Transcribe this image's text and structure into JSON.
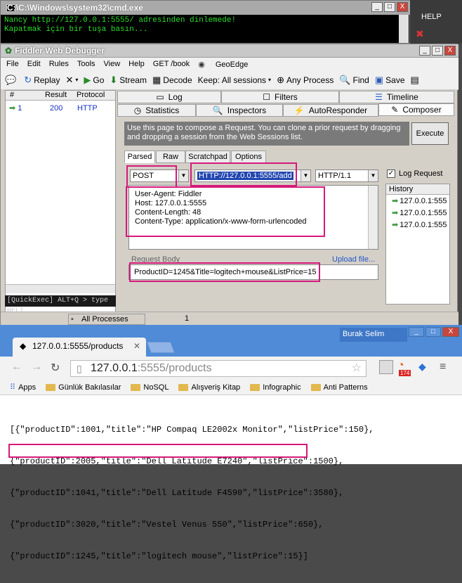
{
  "cmd": {
    "title": "C:\\Windows\\system32\\cmd.exe",
    "lines": [
      "Nancy http://127.0.0.1:5555/ adresinden dinlemede!",
      "Kapatmak için bir tuşa basın..."
    ],
    "buttons": [
      "_",
      "□",
      "X"
    ]
  },
  "side": {
    "help": "HELP"
  },
  "fiddler": {
    "title": "Fiddler Web Debugger",
    "menu": [
      "File",
      "Edit",
      "Rules",
      "Tools",
      "View",
      "Help",
      "GET /book",
      "GeoEdge"
    ],
    "toolbar": {
      "replay": "Replay",
      "go": "Go",
      "stream": "Stream",
      "decode": "Decode",
      "keep": "Keep: All sessions",
      "any_process": "Any Process",
      "find": "Find",
      "save": "Save"
    },
    "sessions": {
      "headers": [
        "#",
        "Result",
        "Protocol"
      ],
      "rows": [
        {
          "num": "1",
          "result": "200",
          "protocol": "HTTP"
        }
      ]
    },
    "quickexec": "[QuickExec] ALT+Q > type HELI",
    "status": {
      "processes": "All Processes",
      "count": "1"
    },
    "tabs_top": [
      "Log",
      "Filters",
      "Timeline"
    ],
    "tabs_bottom": [
      "Statistics",
      "Inspectors",
      "AutoResponder",
      "Composer"
    ],
    "banner": "Use this page to compose a Request. You can clone a prior request by dragging and dropping a session from the Web Sessions list.",
    "execute": "Execute",
    "subtabs": [
      "Parsed",
      "Raw",
      "Scratchpad",
      "Options"
    ],
    "method": "POST",
    "url": "HTTP://127.0.0.1:5555/add",
    "version": "HTTP/1.1",
    "log_request": "Log Request",
    "headers_lines": [
      "User-Agent: Fiddler",
      "Host: 127.0.0.1:5555",
      "Content-Length: 48",
      "Content-Type: application/x-www-form-urlencoded"
    ],
    "request_body_label": "Request Body",
    "upload": "Upload file...",
    "request_body": "ProductID=1245&Title=logitech+mouse&ListPrice=15",
    "history_label": "History",
    "history": [
      "127.0.0.1:555",
      "127.0.0.1:555",
      "127.0.0.1:555"
    ]
  },
  "chrome": {
    "user": "Burak Selim",
    "tab_title": "127.0.0.1:5555/products",
    "url_host": "127.0.0.1",
    "url_rest": ":5555/products",
    "badge": "174",
    "bookmarks": [
      "Apps",
      "Günlük Bakılasılar",
      "NoSQL",
      "Alışveriş Kitap",
      "Infographic",
      "Anti Patterns"
    ],
    "json_lines": [
      "[{\"productID\":1001,\"title\":\"HP Compaq LE2002x Monitor\",\"listPrice\":150},",
      "{\"productID\":2005,\"title\":\"Dell Latitude E7240\",\"listPrice\":1500},",
      "{\"productID\":1041,\"title\":\"Dell Latitude F4590\",\"listPrice\":3580},",
      "{\"productID\":3020,\"title\":\"Vestel Venus 550\",\"listPrice\":650},",
      "{\"productID\":1245,\"title\":\"logitech mouse\",\"listPrice\":15}]"
    ]
  }
}
